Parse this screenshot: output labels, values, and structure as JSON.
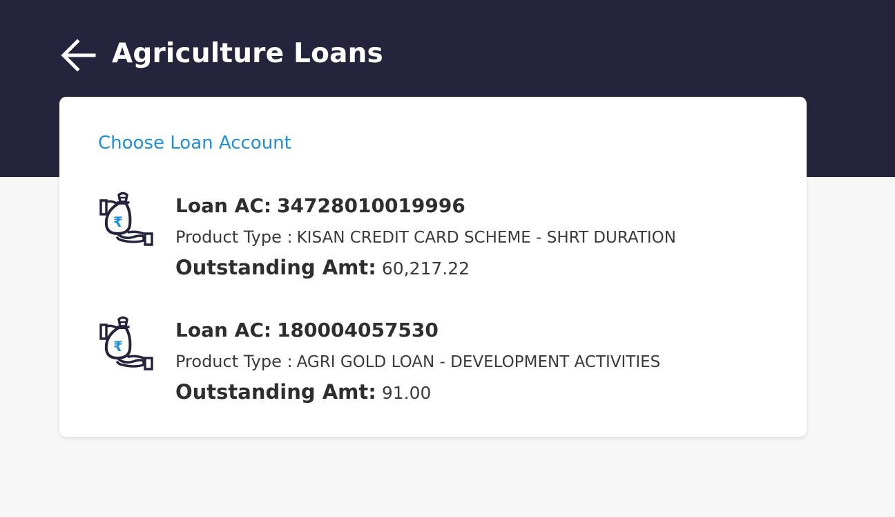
{
  "header": {
    "title": "Agriculture Loans",
    "back_icon": "arrow-left-icon"
  },
  "card": {
    "heading": "Choose Loan Account",
    "accent_color": "#1f8fdb"
  },
  "loans": [
    {
      "ac_label": "Loan AC:",
      "ac_number": "34728010019996",
      "type_label": "Product Type :",
      "type_value": "KISAN CREDIT CARD SCHEME - SHRT DURATION",
      "amt_label": "Outstanding Amt:",
      "amt_value": "60,217.22",
      "icon": "money-bag-hand-icon"
    },
    {
      "ac_label": "Loan AC:",
      "ac_number": "180004057530",
      "type_label": "Product Type :",
      "type_value": "AGRI GOLD LOAN - DEVELOPMENT ACTIVITIES",
      "amt_label": "Outstanding Amt:",
      "amt_value": "91.00",
      "icon": "money-bag-hand-icon"
    }
  ],
  "colors": {
    "header_bg": "#26243d",
    "page_bg": "#f7f7f7",
    "card_bg": "#ffffff",
    "icon_accent": "#1f8fdb"
  }
}
